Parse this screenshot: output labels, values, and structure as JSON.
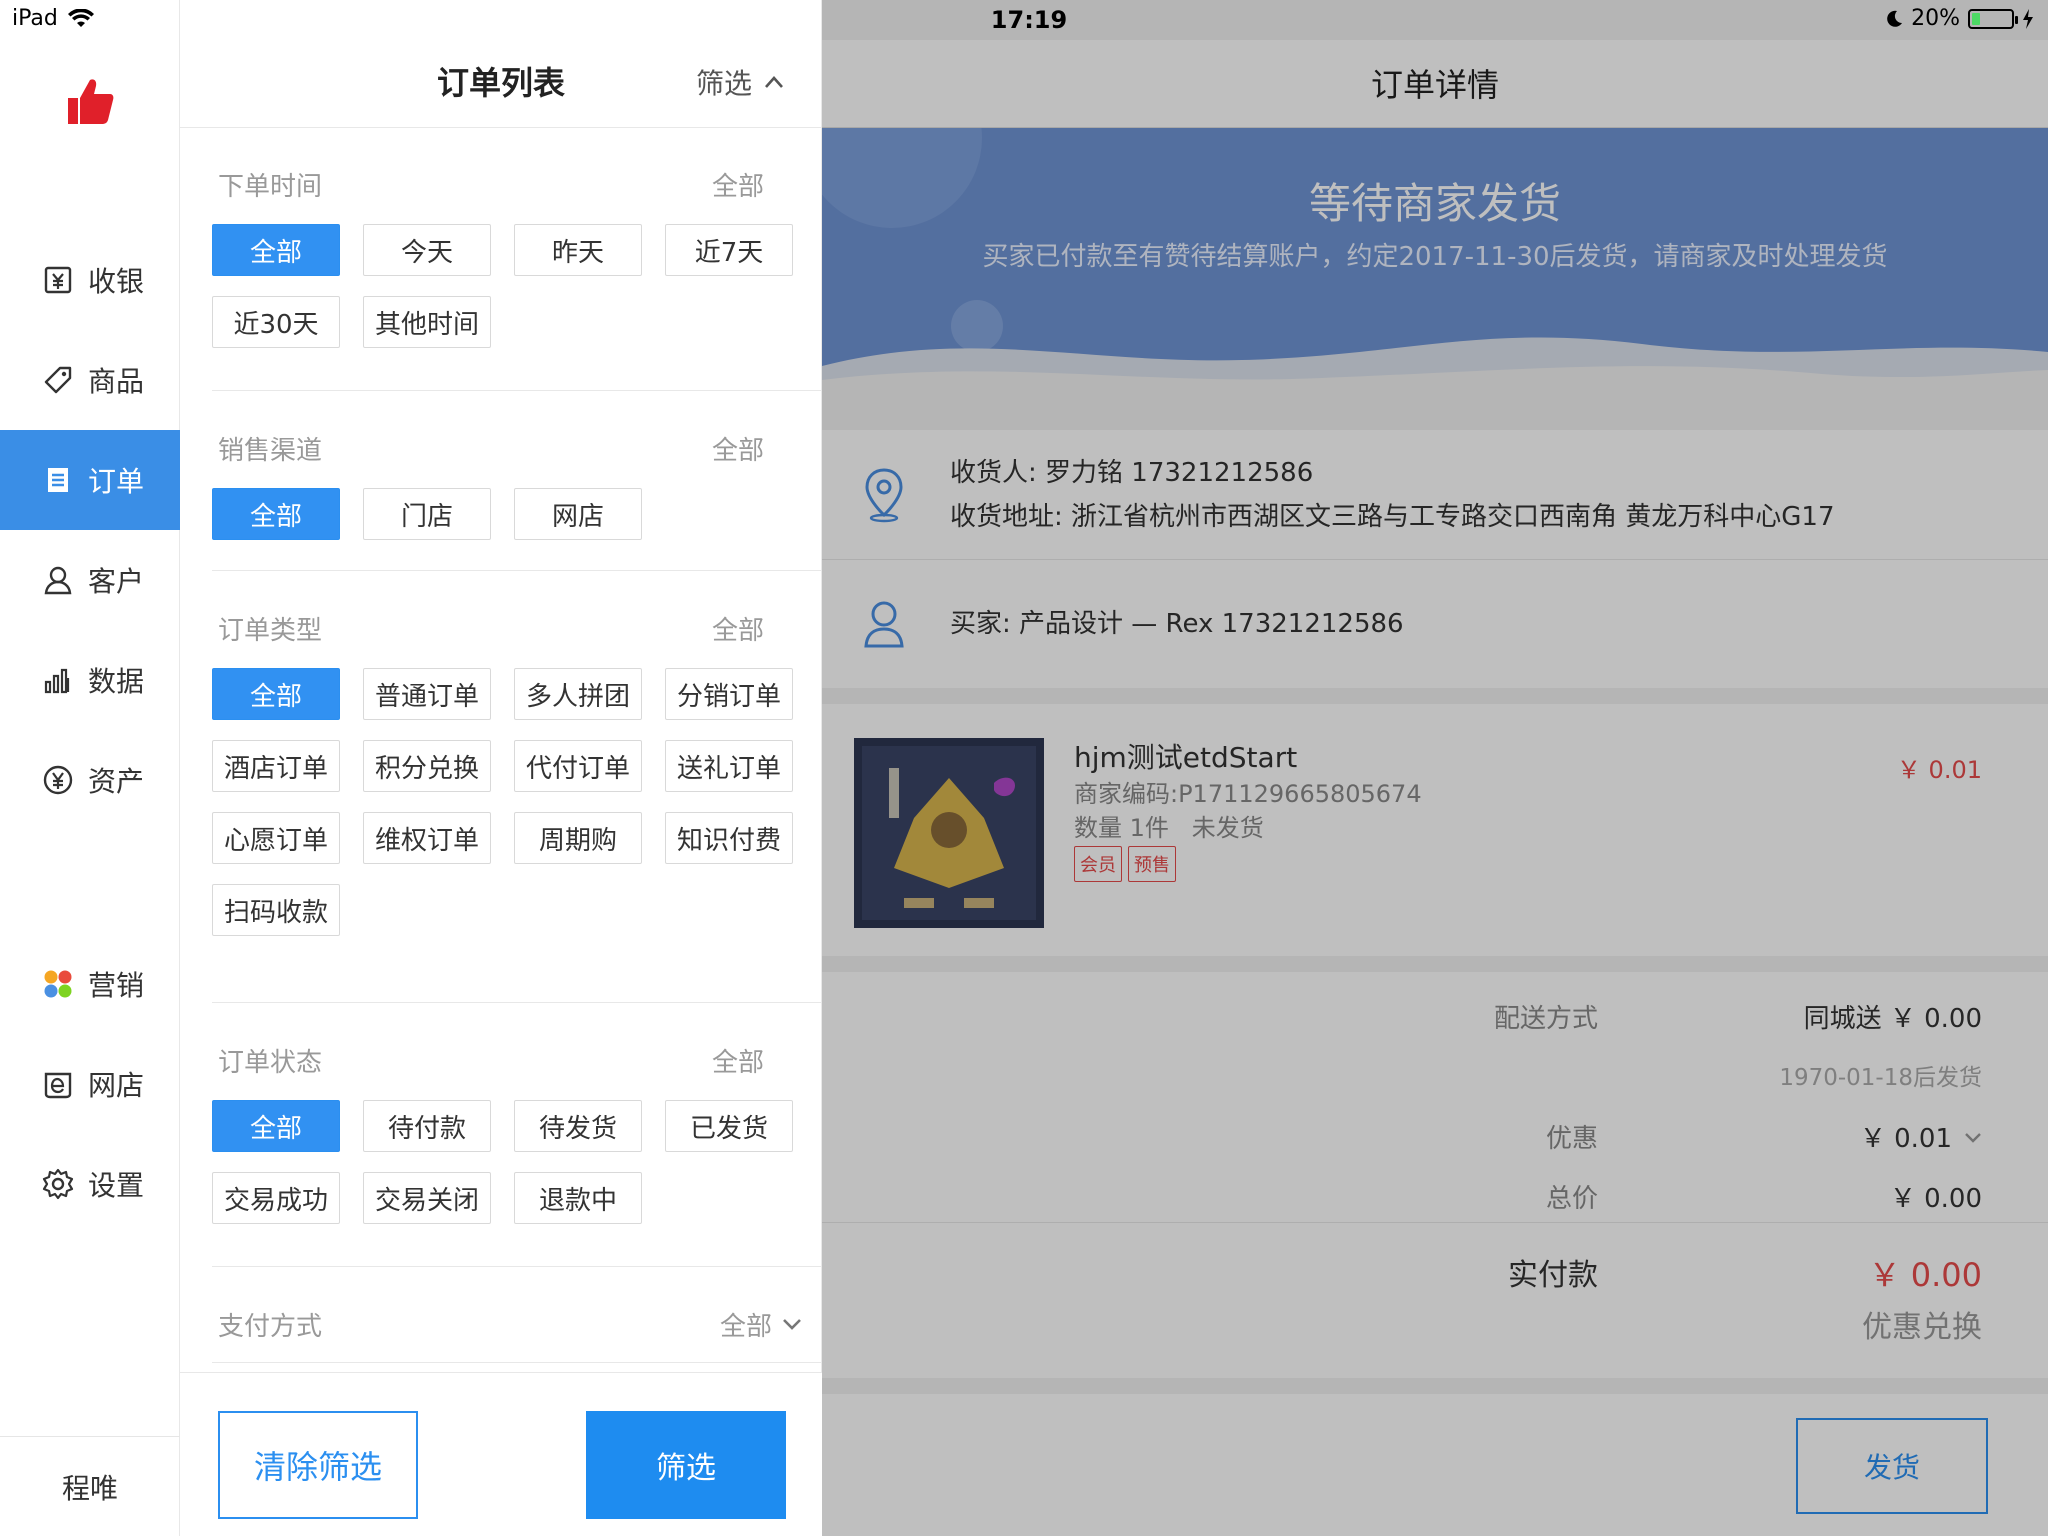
{
  "status_bar": {
    "device": "iPad",
    "time": "17:19",
    "battery": "20%",
    "battery_level": 0.2
  },
  "sidebar": {
    "items": [
      {
        "label": "收银",
        "icon": "cashier-icon"
      },
      {
        "label": "商品",
        "icon": "tag-icon"
      },
      {
        "label": "订单",
        "icon": "order-icon"
      },
      {
        "label": "客户",
        "icon": "user-icon"
      },
      {
        "label": "数据",
        "icon": "bar-chart-icon"
      },
      {
        "label": "资产",
        "icon": "yen-icon"
      },
      {
        "label": "营销",
        "icon": "marketing-icon"
      },
      {
        "label": "网店",
        "icon": "eshop-icon"
      },
      {
        "label": "设置",
        "icon": "gear-icon"
      }
    ],
    "active_item": "订单",
    "user": "程唯"
  },
  "filter_panel": {
    "title": "订单列表",
    "toggle": "筛选",
    "sections": [
      {
        "label": "下单时间",
        "all": "全部",
        "options": [
          "全部",
          "今天",
          "昨天",
          "近7天",
          "近30天",
          "其他时间"
        ]
      },
      {
        "label": "销售渠道",
        "all": "全部",
        "options": [
          "全部",
          "门店",
          "网店"
        ]
      },
      {
        "label": "订单类型",
        "all": "全部",
        "options": [
          "全部",
          "普通订单",
          "多人拼团",
          "分销订单",
          "酒店订单",
          "积分兑换",
          "代付订单",
          "送礼订单",
          "心愿订单",
          "维权订单",
          "周期购",
          "知识付费",
          "扫码收款"
        ]
      },
      {
        "label": "订单状态",
        "all": "全部",
        "options": [
          "全部",
          "待付款",
          "待发货",
          "已发货",
          "交易成功",
          "交易关闭",
          "退款中"
        ]
      },
      {
        "label": "支付方式",
        "all": "全部",
        "options": []
      }
    ],
    "clear_button": "清除筛选",
    "filter_button": "筛选"
  },
  "detail": {
    "title": "订单详情",
    "banner_title": "等待商家发货",
    "banner_sub": "买家已付款至有赞待结算账户，约定2017-11-30后发货，请商家及时处理发货",
    "receiver": "收货人: 罗力铭  17321212586",
    "address": "收货地址: 浙江省杭州市西湖区文三路与工专路交口西南角 黄龙万科中心G17",
    "buyer": "买家: 产品设计 — Rex 17321212586",
    "product": {
      "name": "hjm测试etdStart",
      "code": "商家编码:P171129665805674",
      "qty": "数量 1件",
      "ship_status": "未发货",
      "tags": [
        "会员",
        "预售"
      ],
      "price": "￥ 0.01"
    },
    "summary": {
      "delivery_label": "配送方式",
      "delivery_value": "同城送  ￥ 0.00",
      "ship_date": "1970-01-18后发货",
      "discount_label": "优惠",
      "discount_value": "￥ 0.01",
      "total_label": "总价",
      "total_value": "￥ 0.00",
      "paid_label": "实付款",
      "paid_value": "￥ 0.00",
      "redeem": "优惠兑换"
    },
    "ship_button": "发货"
  },
  "colors": {
    "accent": "#3191f2",
    "price": "#e64b4b",
    "banner": "#6f94d4"
  }
}
